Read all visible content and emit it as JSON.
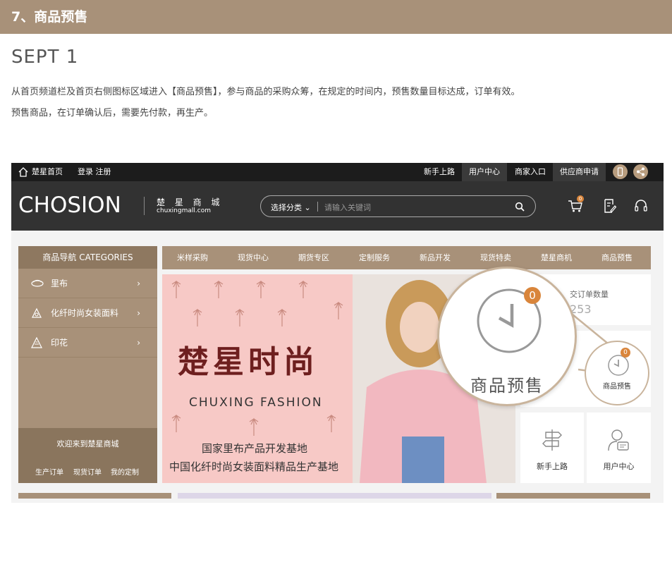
{
  "header": {
    "title": "7、商品预售"
  },
  "step": "SEPT 1",
  "description": {
    "line1": "从首页频道栏及首页右侧图标区域进入【商品预售】，参与商品的采购众筹，在规定的时间内，预售数量目标达成，订单有效。",
    "line2": "预售商品，在订单确认后，需要先付款，再生产。"
  },
  "topbar": {
    "home": "楚星首页",
    "login": "登录 注册",
    "guide": "新手上路",
    "user_center": "用户中心",
    "merchant": "商家入口",
    "supplier": "供应商申请"
  },
  "brand": {
    "logo": "CHOSION",
    "name_cn": "楚 星 商 城",
    "domain": "chuxingmall.com"
  },
  "search": {
    "category": "选择分类",
    "placeholder": "请输入关键词"
  },
  "cart_count": "0",
  "sidebar": {
    "header": "商品导航 CATEGORIES",
    "items": [
      {
        "label": "里布",
        "icon": "fabric-icon"
      },
      {
        "label": "化纤时尚女装面料",
        "icon": "fashion-icon"
      },
      {
        "label": "印花",
        "icon": "print-icon"
      }
    ],
    "welcome": "欢迎来到楚星商城",
    "links": [
      "生产订单",
      "现货订单",
      "我的定制"
    ]
  },
  "nav": [
    "米样采购",
    "现货中心",
    "期货专区",
    "定制服务",
    "新品开发",
    "现货特卖",
    "楚星商机",
    "商品预售"
  ],
  "banner": {
    "title": "楚星时尚",
    "subtitle": "CHUXING FASHION",
    "line1": "国家里布产品开发基地",
    "line2": "中国化纤时尚女装面料精品生产基地"
  },
  "right_panel": {
    "order_label": "交订单数量",
    "order_value": "253",
    "presale_label": "商品预售",
    "presale_badge": "0",
    "guide_label": "新手上路",
    "user_label": "用户中心"
  },
  "magnifier": {
    "label": "商品预售",
    "badge": "0"
  },
  "colors": {
    "accent": "#a89179",
    "dark": "#323232",
    "badge": "#d9853b"
  }
}
